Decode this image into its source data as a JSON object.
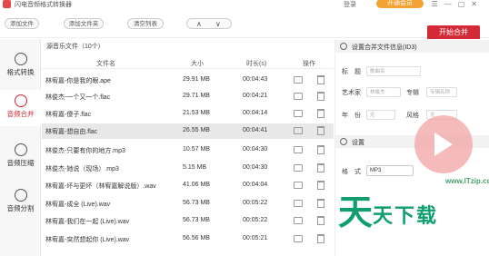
{
  "app": {
    "title": "闪电音频格式转换器",
    "login": "登录",
    "vip": "开通会员"
  },
  "toolbar": {
    "add_file": "添加文件",
    "add_folder": "添加文件夹",
    "clear_list": "清空列表",
    "move_up": "∧",
    "move_down": "∨",
    "start": "开始合并"
  },
  "sidebar": {
    "items": [
      {
        "label": "格式转换",
        "icon": "format-convert-icon"
      },
      {
        "label": "音频合并",
        "icon": "audio-merge-icon"
      },
      {
        "label": "音频压缩",
        "icon": "audio-compress-icon"
      },
      {
        "label": "音频分割",
        "icon": "audio-split-icon"
      }
    ]
  },
  "list": {
    "caption": "源音乐文件（10个）",
    "columns": [
      "文件名",
      "大小",
      "时长(s)",
      "操作"
    ],
    "rows": [
      {
        "name": "林宥嘉-你是我的眼.ape",
        "size": "29.91 MB",
        "duration": "00:04:43"
      },
      {
        "name": "林俊杰-一个又一个.flac",
        "size": "29.71 MB",
        "duration": "00:04:21"
      },
      {
        "name": "林宥嘉-傻子.flac",
        "size": "21.53 MB",
        "duration": "00:04:14"
      },
      {
        "name": "林宥嘉-想自由.flac",
        "size": "26.55 MB",
        "duration": "00:04:41"
      },
      {
        "name": "林俊杰-只要有你的地方.mp3",
        "size": "10.57 MB",
        "duration": "00:04:30"
      },
      {
        "name": "林俊杰-她说（现场）.mp3",
        "size": "5.15 MB",
        "duration": "00:04:30"
      },
      {
        "name": "林宥嘉-坏与更坏（林宥嘉解说版）.wav",
        "size": "41.06 MB",
        "duration": "00:04:04"
      },
      {
        "name": "林宥嘉-成全 (Live).wav",
        "size": "56.73 MB",
        "duration": "00:05:22"
      },
      {
        "name": "林宥嘉-我们在一起 (Live).wav",
        "size": "56.73 MB",
        "duration": "00:05:22"
      },
      {
        "name": "林宥嘉-突然想起你 (Live).wav",
        "size": "56.56 MB",
        "duration": "00:05:21"
      }
    ]
  },
  "merge_info": {
    "heading": "设置合并文件信息(ID3)",
    "title_label": "标　题",
    "title_placeholder": "歌曲名",
    "artist_label": "艺术家",
    "artist_placeholder": "林俊杰",
    "album_label": "专辑",
    "album_placeholder": "专辑名称",
    "year_label": "年　份",
    "year_placeholder": "无",
    "genre_label": "风格",
    "genre_placeholder": "无"
  },
  "settings": {
    "heading": "设置",
    "format_label": "格　式",
    "format_value": "MP3"
  },
  "watermark": {
    "site": "www.ITzip.com",
    "big": "天",
    "small": "天下载"
  }
}
